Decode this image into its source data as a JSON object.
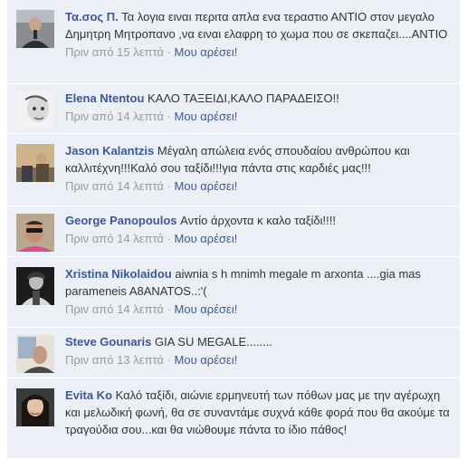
{
  "like_label": "Μου αρέσει!",
  "separator": "·",
  "colors": {
    "author": "#3b5998",
    "background": "#eceff5",
    "meta": "#999999"
  },
  "comments": [
    {
      "avatar": "man-microphone-avatar",
      "author": "Τα.σος Π.",
      "text": "Τα λογια ειναι περιτα απλα ενα τεραστιο ΑΝΤΙΟ στον μεγαλο Δημητρη Μητροπανο ,να ειναι ελαφρη το χωμα που σε σκεπαζει....ΑΝΤΙΟ",
      "time": "Πριν από 15 λεπτά"
    },
    {
      "avatar": "face-sketch-avatar",
      "author": "Elena Ntentou",
      "text": "ΚΑΛΟ ΤΑΞΕΙΔΙ,ΚΑΛΟ ΠΑΡΑΔΕΙΣΟ!!",
      "time": "Πριν από 14 λεπτά"
    },
    {
      "avatar": "group-photo-avatar",
      "author": "Jason Kalantzis",
      "text": "Μέγαλη απώλεια ενός σπουδαίου ανθρώπου και καλλιτέχνη!!!Καλό σου ταξίδι!!!για πάντα στις καρδιές μας!!!",
      "time": "Πριν από 14 λεπτά"
    },
    {
      "avatar": "man-sunglasses-avatar",
      "author": "George Panopoulos",
      "text": "Αντίο άρχοντα κ καλο ταξίδι!!!!",
      "time": "Πριν από 14 λεπτά"
    },
    {
      "avatar": "bw-portrait-avatar",
      "author": "Xristina Nikolaidou",
      "text": "aiwnia s h mnimh megale m arxonta ....gia mas parameneis A8ANATOS..:'(",
      "time": "Πριν από 14 λεπτά"
    },
    {
      "avatar": "man-window-avatar",
      "author": "Steve Gounaris",
      "text": "GIA SU MEGALE........",
      "time": "Πριν από 13 λεπτά"
    },
    {
      "avatar": "woman-dark-hair-avatar",
      "author": "Evita Ko",
      "text": "Καλό ταξίδι, αιώνιε ερμηνευτή των πόθων μας με την αγέρωχη και μελωδική φωνή, θα σε συναντάμε συχνά κάθε φορά που θα ακούμε τα τραγούδια σου...και θα νιώθουμε πάντα το ίδιο πάθος!",
      "time": ""
    }
  ]
}
